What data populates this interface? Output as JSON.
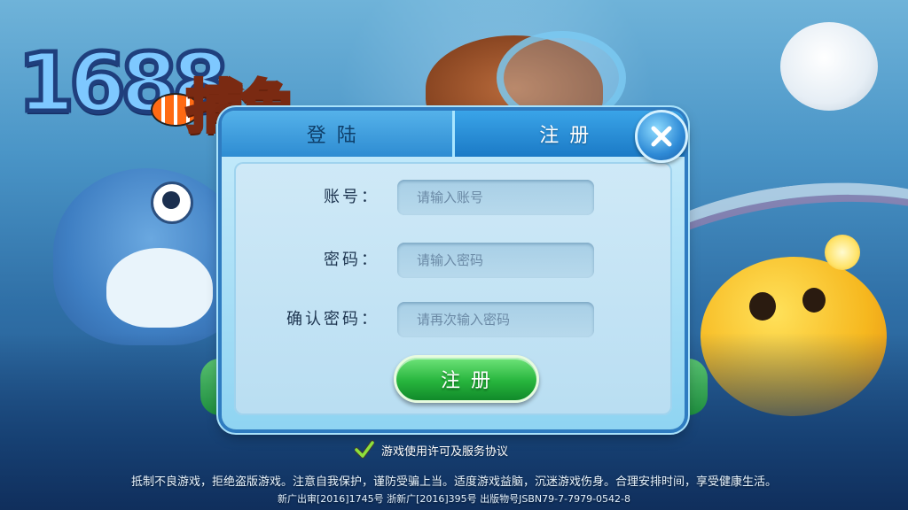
{
  "logo": {
    "number": "1688",
    "chinese": "捕鱼"
  },
  "dialog": {
    "tabs": [
      {
        "label": "登陆",
        "active": false
      },
      {
        "label": "注册",
        "active": true
      }
    ],
    "fields": {
      "account": {
        "label": "账号：",
        "placeholder": "请输入账号"
      },
      "password": {
        "label": "密码：",
        "placeholder": "请输入密码"
      },
      "confirm": {
        "label": "确认密码：",
        "placeholder": "请再次输入密码"
      }
    },
    "submit_label": "注册",
    "close_icon": "close-icon"
  },
  "agreement": {
    "checked": true,
    "text": "游戏使用许可及服务协议"
  },
  "footer": {
    "notice": "抵制不良游戏，拒绝盗版游戏。注意自我保护，谨防受骗上当。适度游戏益脑，沉迷游戏伤身。合理安排时间，享受健康生活。",
    "license": "新广出审[2016]1745号    浙新广[2016]395号    出版物号JSBN79-7-7979-0542-8"
  },
  "colors": {
    "tab_active": "#1b7ac6",
    "submit_green": "#27b53d",
    "panel_bg": "#cfe9f7"
  }
}
